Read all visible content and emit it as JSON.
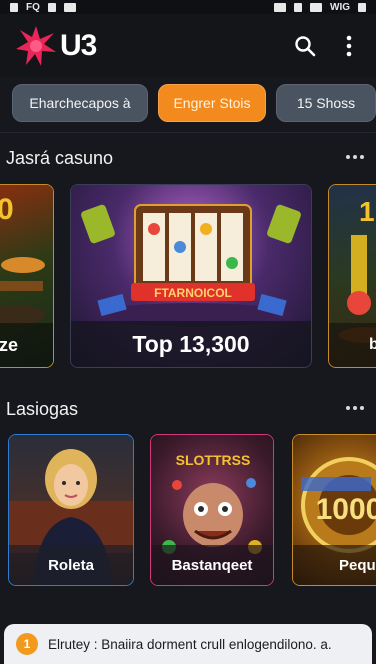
{
  "status_bar": {
    "left_text": "FQ",
    "right_text": "WIG"
  },
  "header": {
    "logo_text": "U3"
  },
  "chips": [
    {
      "label": "Eharchecapos à",
      "active": false
    },
    {
      "label": "Engrer Stois",
      "active": true
    },
    {
      "label": "15 Shoss",
      "active": false
    }
  ],
  "section1": {
    "title": "Jasrá casuno",
    "cards": [
      {
        "label": "ze"
      },
      {
        "label": "Top 13,300",
        "art_text": "FTARNOICOL"
      },
      {
        "label": "b"
      }
    ]
  },
  "section2": {
    "title": "Lasiogas",
    "cards": [
      {
        "label": "Roleta"
      },
      {
        "label": "Bastanqeet",
        "art_text": "SLOTTRSS"
      },
      {
        "label": "Pequ",
        "art_text": "1000"
      }
    ]
  },
  "notice": {
    "badge": "1",
    "text": "Elrutey : Bnaiira dorment crull enlogendilono. a."
  },
  "colors": {
    "accent": "#f28a1e",
    "chip": "#4a5360",
    "background": "#16181d"
  }
}
